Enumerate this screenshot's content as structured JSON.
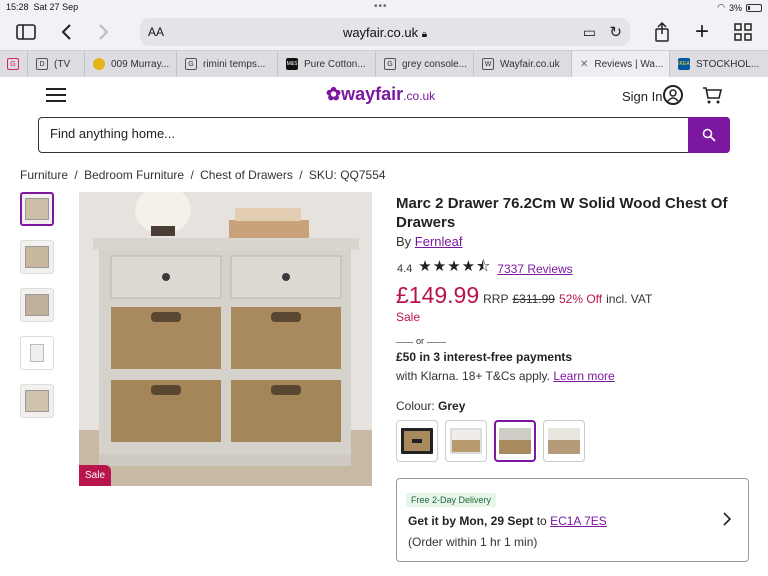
{
  "status_bar": {
    "time": "15:28",
    "date": "Sat 27 Sep",
    "battery": "3%"
  },
  "browser": {
    "text_size_label": "AA",
    "url": "wayfair.co.uk",
    "tabs": [
      {
        "label": "(TV",
        "icon": "tab-icon"
      },
      {
        "label": "009 Murray...",
        "icon": "tab-icon"
      },
      {
        "label": "rimini temps...",
        "icon": "google-icon"
      },
      {
        "label": "Pure Cotton...",
        "icon": "ms-icon"
      },
      {
        "label": "grey console...",
        "icon": "google-icon"
      },
      {
        "label": "Wayfair.co.uk",
        "icon": "wayfair-icon"
      },
      {
        "label": "Reviews | Wa...",
        "icon": "close-icon"
      },
      {
        "label": "STOCKHOL...",
        "icon": "ikea-icon"
      }
    ]
  },
  "site": {
    "logo_main": "wayfair",
    "logo_suffix": ".co.uk",
    "sign_in": "Sign In",
    "search_placeholder": "Find anything home...",
    "brand_color": "#7b189f"
  },
  "breadcrumb": [
    "Furniture",
    "/",
    "Bedroom Furniture",
    "/",
    "Chest of Drawers",
    "/",
    "SKU: QQ7554"
  ],
  "product": {
    "title": "Marc 2 Drawer 76.2Cm W Solid Wood Chest Of Drawers",
    "by": "By",
    "brand": "Fernleaf",
    "rating": "4.4",
    "reviews": "7337 Reviews",
    "price": "£149.99",
    "rrp_label": "RRP",
    "rrp": "£311.99",
    "discount": "52% Off",
    "vat": "incl. VAT",
    "sale": "Sale",
    "or": "or",
    "klarna_line1": "£50 in 3 interest-free payments",
    "klarna_line2": "with Klarna. 18+ T&Cs apply.",
    "learn_more": "Learn more",
    "colour_label": "Colour:",
    "colour_value": "Grey",
    "sale_badge": "Sale",
    "sale_color": "#b8154c"
  },
  "delivery": {
    "tag": "Free 2-Day Delivery",
    "get_it": "Get it by Mon, 29 Sept",
    "to": "to",
    "postcode": "EC1A 7ES",
    "within": "(Order within 1 hr 1 min)"
  }
}
